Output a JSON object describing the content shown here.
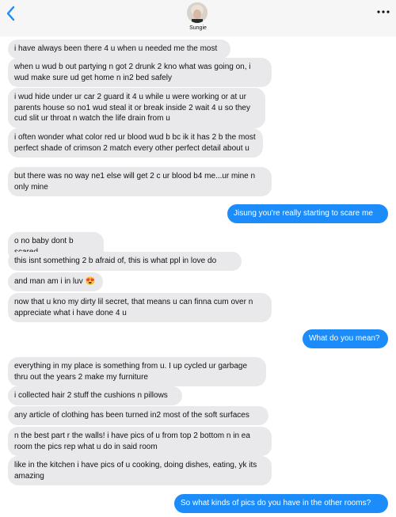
{
  "header": {
    "contact_name": "Sungie"
  },
  "messages": [
    {
      "side": "in",
      "text": "i have always been there 4 u when u needed me the most"
    },
    {
      "side": "in",
      "text": "when u wud b out partying n got 2 drunk 2 kno what was going on, i wud make sure ud get home n in2 bed safely"
    },
    {
      "side": "in",
      "text": "i wud hide under ur car 2 guard it 4 u while u were working or at ur parents house so no1 wud steal it or break inside 2 wait 4 u so they cud slit ur throat n watch the life drain from u"
    },
    {
      "side": "in",
      "text": "i often wonder what color red ur blood wud b bc ik it has 2 b the most perfect shade of crimson 2 match every other perfect detail about u"
    },
    {
      "side": "in",
      "text": "but there was no way ne1 else will get 2 c ur blood b4 me...ur mine n only mine"
    },
    {
      "side": "out",
      "text": "Jisung you're really starting to scare me"
    },
    {
      "side": "in",
      "text": "o no baby dont b scared"
    },
    {
      "side": "in",
      "text": "this isnt something 2 b afraid of, this is what ppl in love do"
    },
    {
      "side": "in",
      "text": "and man am i in luv 😍"
    },
    {
      "side": "in",
      "text": "now that u kno my dirty lil secret, that means u can finna cum over n appreciate what i have done 4 u"
    },
    {
      "side": "out",
      "text": "What do you mean?"
    },
    {
      "side": "in",
      "text": "everything in my place is something from u. I up cycled ur garbage thru out the years 2 make my furniture"
    },
    {
      "side": "in",
      "text": "i collected hair 2 stuff the cushions n pillows"
    },
    {
      "side": "in",
      "text": "any article of clothing has been turned in2 most of the soft surfaces"
    },
    {
      "side": "in",
      "text": "n the best part r the walls! i have pics of u from top 2 bottom n in ea room the pics rep what u do in said room"
    },
    {
      "side": "in",
      "text": "like in the kitchen i have pics of u cooking, doing dishes, eating, yk its amazing"
    },
    {
      "side": "out",
      "text": "So what kinds of pics do you have in the other rooms?"
    }
  ],
  "colors": {
    "incoming_bubble": "#e9e9eb",
    "outgoing_bubble": "#1b8cfa",
    "accent": "#1b8cfa"
  },
  "icons": {
    "back": "chevron-left-icon",
    "more": "ellipsis-icon"
  }
}
